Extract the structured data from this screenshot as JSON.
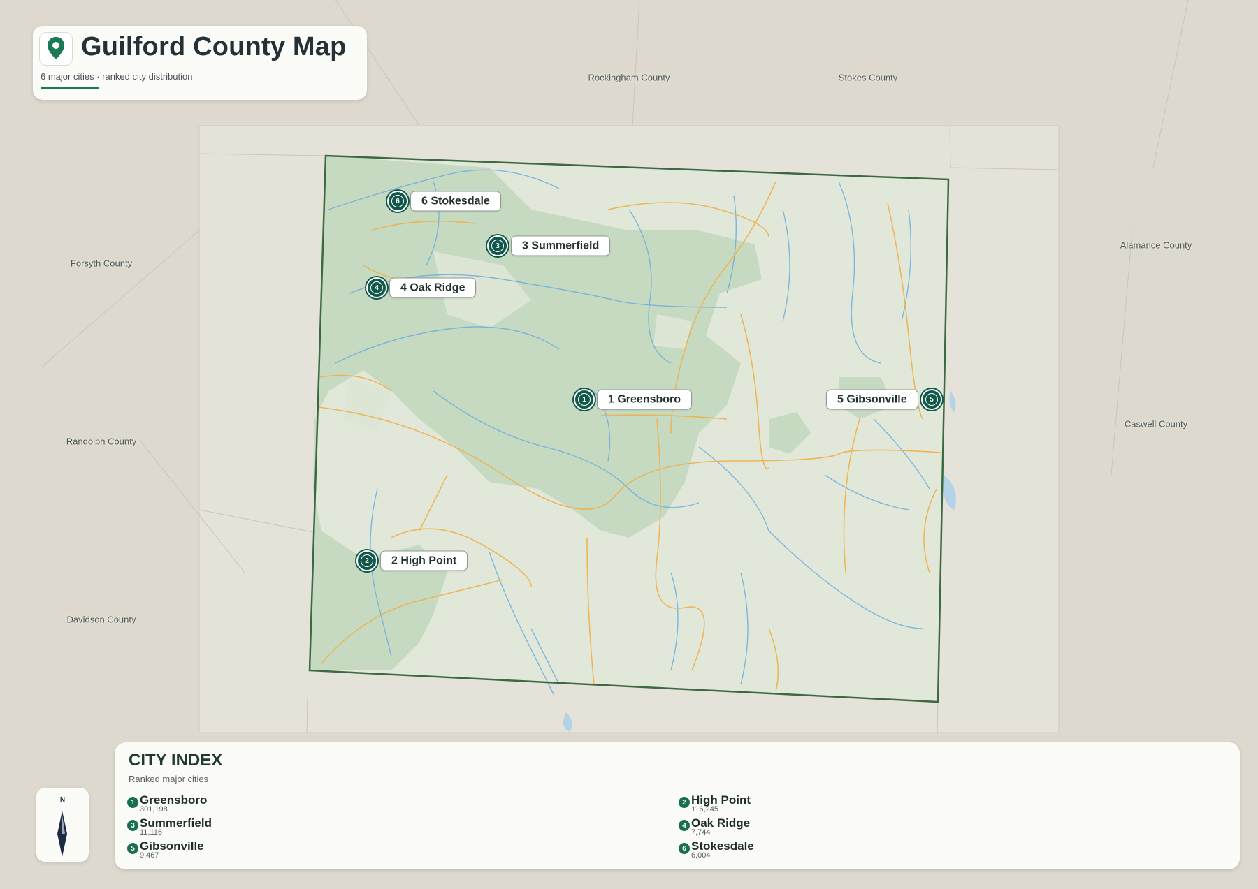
{
  "header": {
    "title": "Guilford County Map",
    "subtitle": "6 major cities · ranked city distribution",
    "icon": "map-pin-icon"
  },
  "neighbor_counties": [
    {
      "name": "Rockingham County"
    },
    {
      "name": "Stokes County"
    },
    {
      "name": "Forsyth County"
    },
    {
      "name": "Alamance County"
    },
    {
      "name": "Caswell County"
    },
    {
      "name": "Randolph County"
    },
    {
      "name": "Davidson County"
    }
  ],
  "cities": [
    {
      "rank": "1",
      "label": "1 Greensboro",
      "name": "Greensboro",
      "population": "301,198"
    },
    {
      "rank": "2",
      "label": "2 High Point",
      "name": "High Point",
      "population": "116,245"
    },
    {
      "rank": "3",
      "label": "3 Summerfield",
      "name": "Summerfield",
      "population": "11,116"
    },
    {
      "rank": "4",
      "label": "4 Oak Ridge",
      "name": "Oak Ridge",
      "population": "7,744"
    },
    {
      "rank": "5",
      "label": "5 Gibsonville",
      "name": "Gibsonville",
      "population": "9,467"
    },
    {
      "rank": "6",
      "label": "6 Stokesdale",
      "name": "Stokesdale",
      "population": "6,004"
    }
  ],
  "index": {
    "title": "CITY INDEX",
    "subtitle": "Ranked major cities"
  },
  "compass": {
    "label": "N",
    "icon": "north-arrow-icon"
  },
  "colors": {
    "accent": "#1a7a55",
    "marker": "#12584a",
    "county_fill": "#c9dcc4",
    "county_border": "#3b6a42",
    "water": "#6aaee0",
    "roads": "#f0b04a",
    "background": "#ddd9cf"
  }
}
